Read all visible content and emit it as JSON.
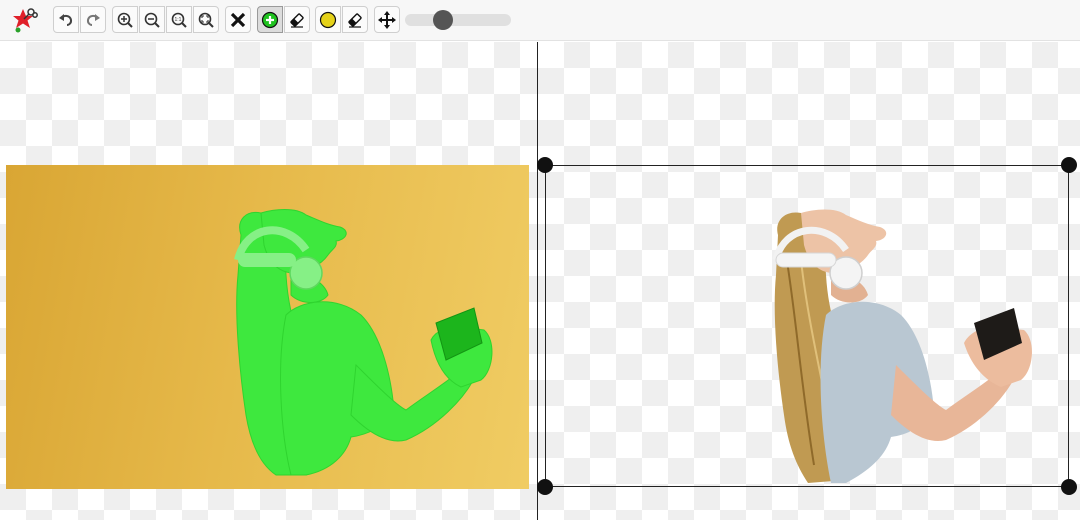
{
  "app": {
    "logo_icon": "app-logo-star-scissors-icon"
  },
  "toolbar": {
    "buttons": [
      {
        "name": "undo-button",
        "icon": "undo-icon"
      },
      {
        "name": "redo-button",
        "icon": "redo-icon"
      },
      {
        "name": "zoom-in-button",
        "icon": "zoom-in-icon"
      },
      {
        "name": "zoom-out-button",
        "icon": "zoom-out-icon"
      },
      {
        "name": "zoom-actual-size-button",
        "icon": "zoom-1-1-icon",
        "label": "1:1"
      },
      {
        "name": "zoom-fit-button",
        "icon": "zoom-fit-icon"
      },
      {
        "name": "clear-button",
        "icon": "close-x-icon"
      },
      {
        "name": "keep-brush-button",
        "icon": "green-plus-brush-icon",
        "active": true
      },
      {
        "name": "keep-eraser-button",
        "icon": "eraser-icon"
      },
      {
        "name": "hair-brush-button",
        "icon": "yellow-brush-icon"
      },
      {
        "name": "hair-eraser-button",
        "icon": "eraser-icon"
      },
      {
        "name": "pan-button",
        "icon": "move-arrows-icon"
      }
    ],
    "brush_size_slider": {
      "value_fraction": 0.33
    }
  },
  "colors": {
    "keep_mark": "#22dd22",
    "hair_mark": "#e5d21a",
    "active_button_bg": "#dcdcdc",
    "backdrop_yellow": "#e6b94a"
  },
  "workspace": {
    "left_pane": "original-image-with-keep-mask",
    "right_pane": "cutout-result-preview",
    "crop_handles": [
      "top-left",
      "top-right",
      "bottom-left",
      "bottom-right"
    ]
  }
}
